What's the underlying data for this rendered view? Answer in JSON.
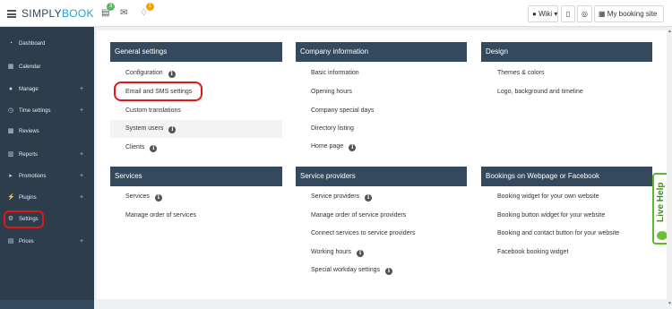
{
  "brand": {
    "part1": "SIMPLY",
    "part2": "BOOK"
  },
  "topbar": {
    "badges": {
      "tasks": "3",
      "notifications": "1"
    },
    "wiki_label": "Wiki",
    "my_booking_site": "My booking site"
  },
  "sidebar": {
    "items": [
      {
        "label": "Dashboard"
      },
      {
        "label": "Calendar"
      },
      {
        "label": "Manage",
        "expand": "+"
      },
      {
        "label": "Time settings",
        "expand": "+"
      },
      {
        "label": "Reviews"
      },
      {
        "label": "Reports",
        "expand": "+"
      },
      {
        "label": "Promotions",
        "expand": "+"
      },
      {
        "label": "Plugins",
        "expand": "+"
      },
      {
        "label": "Settings"
      },
      {
        "label": "Prices",
        "expand": "+"
      }
    ]
  },
  "panels": {
    "general": {
      "title": "General settings",
      "links": [
        "Configuration",
        "Email and SMS settings",
        "Custom translations",
        "System users",
        "Clients"
      ]
    },
    "company": {
      "title": "Company information",
      "links": [
        "Basic information",
        "Opening hours",
        "Company special days",
        "Directory listing",
        "Home page"
      ]
    },
    "design": {
      "title": "Design",
      "links": [
        "Themes & colors",
        "Logo, background and timeline"
      ]
    },
    "services": {
      "title": "Services",
      "links": [
        "Services",
        "Manage order of services"
      ]
    },
    "providers": {
      "title": "Service providers",
      "links": [
        "Service providers",
        "Manage order of service providers",
        "Connect services to service providers",
        "Working hours",
        "Special workday settings"
      ]
    },
    "bookings": {
      "title": "Bookings on Webpage or Facebook",
      "links": [
        "Booking widget for your own website",
        "Booking button widget for your website",
        "Booking and contact button for your website",
        "Facebook booking widget"
      ]
    }
  },
  "live_help": {
    "label": "Live Help"
  },
  "colors": {
    "sidebar": "#2e3d4c",
    "panel_header": "#34495e",
    "brand_accent": "#2b9fd8",
    "highlight_red": "#e01818",
    "live_help_green": "#5fb829"
  }
}
